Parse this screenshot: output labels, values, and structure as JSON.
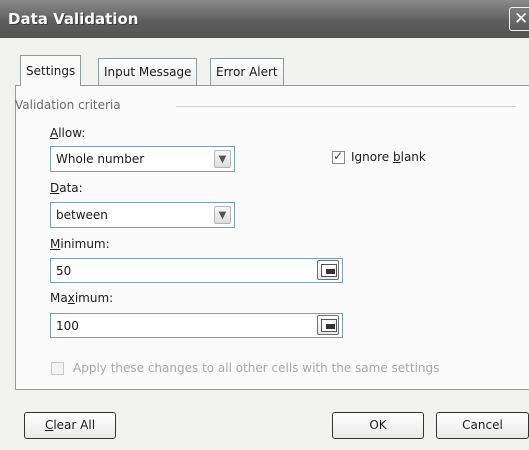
{
  "window": {
    "title": "Data Validation",
    "close_symbol": "✕"
  },
  "tabs": [
    {
      "label": "Settings",
      "active": true
    },
    {
      "label": "Input Message",
      "active": false
    },
    {
      "label": "Error Alert",
      "active": false
    }
  ],
  "validation_criteria": {
    "group_label": "Validation criteria",
    "allow": {
      "label_pre": "",
      "label_key": "A",
      "label_post": "llow:",
      "value": "Whole number"
    },
    "ignore_blank": {
      "label_pre": "Ignore ",
      "label_key": "b",
      "label_post": "lank",
      "checked": true
    },
    "data": {
      "label_pre": "",
      "label_key": "D",
      "label_post": "ata:",
      "value": "between"
    },
    "minimum": {
      "label_pre": "",
      "label_key": "M",
      "label_post": "inimum:",
      "value": "50"
    },
    "maximum": {
      "label_pre": "Ma",
      "label_key": "x",
      "label_post": "imum:",
      "value": "100"
    }
  },
  "apply_all": {
    "label": "Apply these changes to all other cells with the same settings",
    "checked": false,
    "enabled": false
  },
  "buttons": {
    "clear_all": {
      "key": "C",
      "rest": "lear All"
    },
    "ok": "OK",
    "cancel": "Cancel"
  },
  "icons": {
    "dropdown": "chevron-down-icon",
    "collapse_dialog": "range-select-icon",
    "close": "close-icon"
  }
}
